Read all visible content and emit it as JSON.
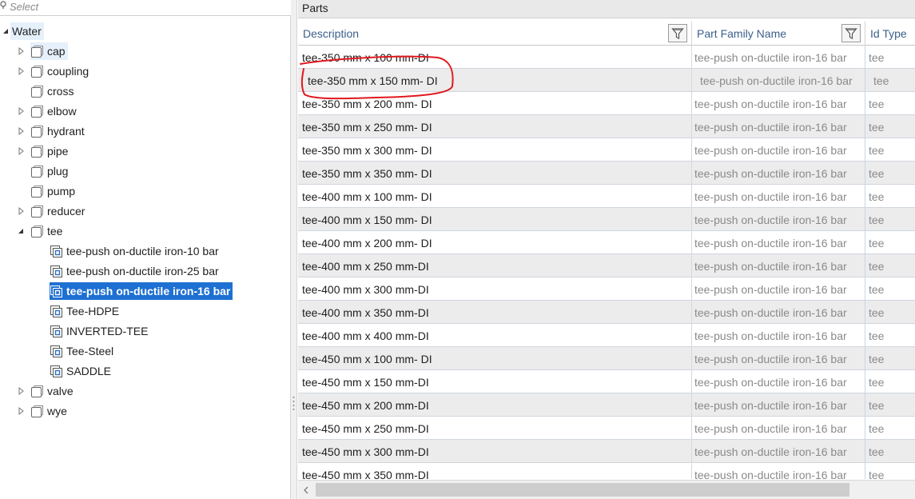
{
  "search": {
    "placeholder": "Select"
  },
  "tree": {
    "root": {
      "label": "Water"
    },
    "items": [
      {
        "label": "cap"
      },
      {
        "label": "coupling"
      },
      {
        "label": "cross"
      },
      {
        "label": "elbow"
      },
      {
        "label": "hydrant"
      },
      {
        "label": "pipe"
      },
      {
        "label": "plug"
      },
      {
        "label": "pump"
      },
      {
        "label": "reducer"
      },
      {
        "label": "tee"
      },
      {
        "label": "tee-push on-ductile iron-10 bar"
      },
      {
        "label": "tee-push on-ductile iron-25 bar"
      },
      {
        "label": "tee-push on-ductile iron-16 bar"
      },
      {
        "label": "Tee-HDPE"
      },
      {
        "label": "INVERTED-TEE"
      },
      {
        "label": "Tee-Steel"
      },
      {
        "label": "SADDLE"
      },
      {
        "label": "valve"
      },
      {
        "label": "wye"
      }
    ]
  },
  "parts": {
    "title": "Parts",
    "columns": [
      "Description",
      "Part Family Name",
      "Id Type"
    ],
    "rows": [
      [
        "tee-350 mm x 100 mm-DI",
        "tee-push on-ductile iron-16 bar",
        "tee"
      ],
      [
        "tee-350 mm x 150 mm- DI",
        "tee-push on-ductile iron-16 bar",
        "tee"
      ],
      [
        "tee-350 mm x 200 mm- DI",
        "tee-push on-ductile iron-16 bar",
        "tee"
      ],
      [
        "tee-350 mm x 250 mm- DI",
        "tee-push on-ductile iron-16 bar",
        "tee"
      ],
      [
        "tee-350 mm x 300 mm- DI",
        "tee-push on-ductile iron-16 bar",
        "tee"
      ],
      [
        "tee-350 mm x 350 mm- DI",
        "tee-push on-ductile iron-16 bar",
        "tee"
      ],
      [
        "tee-400 mm x 100 mm- DI",
        "tee-push on-ductile iron-16 bar",
        "tee"
      ],
      [
        "tee-400 mm x 150 mm- DI",
        "tee-push on-ductile iron-16 bar",
        "tee"
      ],
      [
        "tee-400 mm x 200 mm- DI",
        "tee-push on-ductile iron-16 bar",
        "tee"
      ],
      [
        "tee-400 mm x 250 mm-DI",
        "tee-push on-ductile iron-16 bar",
        "tee"
      ],
      [
        "tee-400 mm x 300 mm-DI",
        "tee-push on-ductile iron-16 bar",
        "tee"
      ],
      [
        "tee-400 mm x 350 mm-DI",
        "tee-push on-ductile iron-16 bar",
        "tee"
      ],
      [
        "tee-400 mm x 400 mm-DI",
        "tee-push on-ductile iron-16 bar",
        "tee"
      ],
      [
        "tee-450 mm x 100 mm- DI",
        "tee-push on-ductile iron-16 bar",
        "tee"
      ],
      [
        "tee-450 mm x 150 mm-DI",
        "tee-push on-ductile iron-16 bar",
        "tee"
      ],
      [
        "tee-450 mm x 200 mm-DI",
        "tee-push on-ductile iron-16 bar",
        "tee"
      ],
      [
        "tee-450 mm x 250 mm-DI",
        "tee-push on-ductile iron-16 bar",
        "tee"
      ],
      [
        "tee-450 mm x 300 mm-DI",
        "tee-push on-ductile iron-16 bar",
        "tee"
      ],
      [
        "tee-450 mm x 350 mm-DI",
        "tee-push on-ductile iron-16 bar",
        "tee"
      ]
    ]
  },
  "colors": {
    "selection": "#1e70d2",
    "header_text": "#3c5f8a",
    "annotation": "#e0191f"
  },
  "icons": {
    "search": "search-icon",
    "filter": "filter-icon",
    "family": "part-family-icon",
    "size": "part-size-icon"
  }
}
